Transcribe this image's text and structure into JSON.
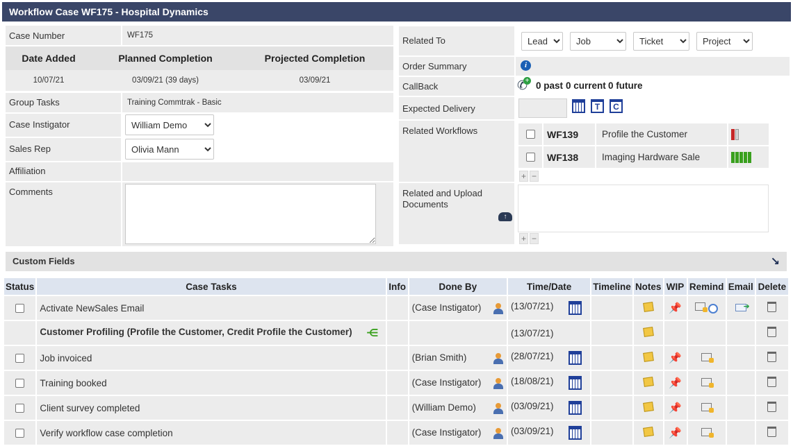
{
  "title": "Workflow Case WF175 - Hospital Dynamics",
  "left": {
    "case_number_label": "Case Number",
    "case_number": "WF175",
    "date_added_hdr": "Date Added",
    "planned_hdr": "Planned Completion",
    "projected_hdr": "Projected Completion",
    "date_added": "10/07/21",
    "planned": "03/09/21 (39 days)",
    "projected": "03/09/21",
    "group_tasks_label": "Group Tasks",
    "group_tasks": "Training Commtrak - Basic",
    "instigator_label": "Case Instigator",
    "instigator": "William Demo",
    "sales_rep_label": "Sales Rep",
    "sales_rep": "Olivia Mann",
    "affiliation_label": "Affiliation",
    "comments_label": "Comments",
    "comments": ""
  },
  "right": {
    "related_to_label": "Related To",
    "related_selects": [
      "Lead",
      "Job",
      "Ticket",
      "Project"
    ],
    "order_summary_label": "Order Summary",
    "callback_label": "CallBack",
    "callback_past": "0 past",
    "callback_current": "0 current",
    "callback_future": "0 future",
    "expected_delivery_label": "Expected Delivery",
    "expected_delivery": "",
    "cal_t": "T",
    "cal_c": "C",
    "related_workflows_label": "Related Workflows",
    "workflows": [
      {
        "id": "WF139",
        "name": "Profile the Customer",
        "progress": 0.25
      },
      {
        "id": "WF138",
        "name": "Imaging Hardware Sale",
        "progress": 1.0
      }
    ],
    "documents_label": "Related and Upload Documents",
    "plus": "+",
    "minus": "−"
  },
  "custom_fields_label": "Custom Fields",
  "table": {
    "headers": [
      "Status",
      "Case Tasks",
      "Info",
      "Done By",
      "Time/Date",
      "Timeline",
      "Notes",
      "WIP",
      "Remind",
      "Email",
      "Delete"
    ],
    "rows": [
      {
        "task": "Activate NewSales Email",
        "done_by": "(Case Instigator)",
        "date": "(13/07/21)"
      },
      {
        "task": "Customer Profiling (Profile the Customer, Credit Profile the Customer)",
        "done_by": "",
        "date": "(13/07/21)"
      },
      {
        "task": "Job invoiced",
        "done_by": "(Brian Smith)",
        "date": "(28/07/21)"
      },
      {
        "task": "Training booked",
        "done_by": "(Case Instigator)",
        "date": "(18/08/21)"
      },
      {
        "task": "Client survey completed",
        "done_by": "(William Demo)",
        "date": "(03/09/21)"
      },
      {
        "task": "Verify workflow case completion",
        "done_by": "(Case Instigator)",
        "date": "(03/09/21)"
      }
    ]
  },
  "colors": {
    "header": "#3a4668",
    "accent_green": "#2a7a2a",
    "progress_red": "#c62828",
    "progress_green": "#3aa01e"
  }
}
